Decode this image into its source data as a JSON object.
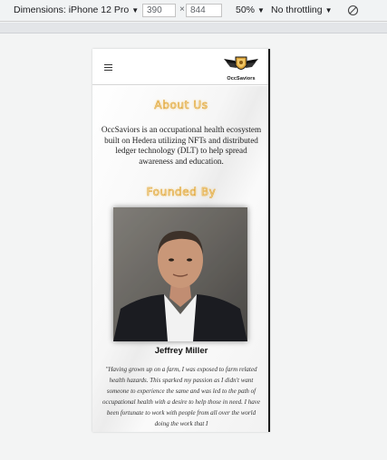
{
  "devtools": {
    "device_label": "Dimensions: iPhone 12 Pro",
    "width_value": "390",
    "height_value": "844",
    "times_symbol": "×",
    "zoom_label": "50%",
    "throttle_label": "No throttling",
    "caret": "▼",
    "icons": [
      "caret-down-icon",
      "rotate-icon"
    ]
  },
  "site": {
    "logo_text": "OccSaviors",
    "menu_icon": "hamburger-menu-icon",
    "about": {
      "title": "About Us",
      "body": "OccSaviors is an occupational health ecosystem built on Hedera utilizing NFTs and distributed ledger technology (DLT) to help spread awareness and education."
    },
    "founded": {
      "title": "Founded By",
      "name": "Jeffrey Miller",
      "quote": "\"Having grown up on a farm, I was exposed to farm related health hazards. This sparked my passion as I didn't want someone to experience the same and was led to the path of occupational health with a desire to help those in need. I have been fortunate to work with people from all over the world doing the work that I"
    }
  },
  "colors": {
    "title_gold": "#e1a63a",
    "title_fill": "#f6e3b5",
    "text": "#222222"
  }
}
